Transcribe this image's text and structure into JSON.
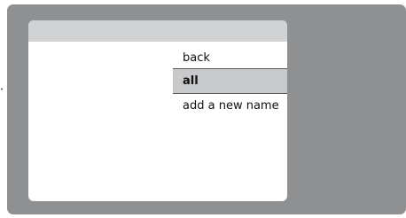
{
  "menu": {
    "items": [
      {
        "label": "back",
        "selected": false
      },
      {
        "label": "all",
        "selected": true
      },
      {
        "label": "add a new name",
        "selected": false
      }
    ]
  },
  "side_marker": "•",
  "colors": {
    "outer_panel": "#8f9092",
    "dialog_header": "#d1d2d4",
    "selected_row": "#c8c9cb",
    "divider": "#5a5a5a"
  }
}
